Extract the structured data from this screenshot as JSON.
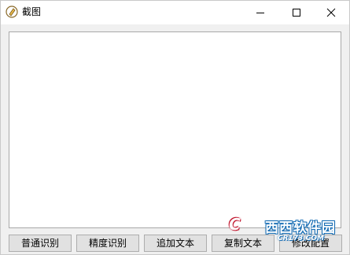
{
  "window": {
    "title": "截图",
    "app_icon": "pencil-icon"
  },
  "controls": {
    "minimize_icon": "minimize-icon",
    "maximize_icon": "maximize-icon",
    "close_icon": "close-icon"
  },
  "editor": {
    "value": ""
  },
  "buttons": [
    {
      "label": "普通识别"
    },
    {
      "label": "精度识别"
    },
    {
      "label": "追加文本"
    },
    {
      "label": "复制文本"
    },
    {
      "label": "修改配置"
    }
  ],
  "watermark": {
    "brand_cn": "西西软件园",
    "brand_en": "CR173.COM",
    "badge": "C"
  }
}
